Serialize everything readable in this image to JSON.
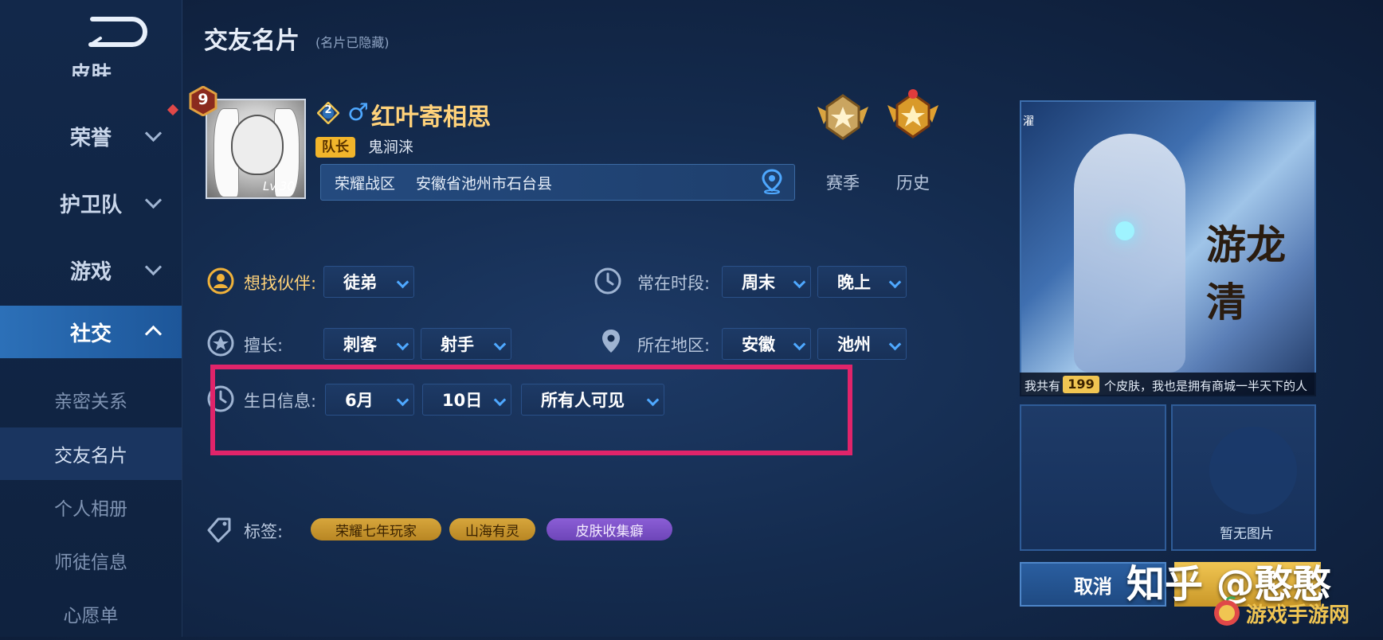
{
  "header": {
    "title": "交友名片",
    "subtitle": "(名片已隐藏)"
  },
  "sidebar": {
    "items": [
      {
        "label": "皮肤",
        "partial": true
      },
      {
        "label": "荣誉"
      },
      {
        "label": "护卫队"
      },
      {
        "label": "游戏"
      },
      {
        "label": "社交",
        "active": true
      }
    ],
    "subitems": [
      {
        "label": "亲密关系"
      },
      {
        "label": "交友名片",
        "current": true
      },
      {
        "label": "个人相册"
      },
      {
        "label": "师徒信息"
      },
      {
        "label": "心愿单"
      }
    ]
  },
  "profile": {
    "rank_number": "9",
    "avatar_level": "Lv.30",
    "level_badge": "2",
    "gender_icon": "♂",
    "name": "红叶寄相思",
    "captain_tag": "队长",
    "team_name": "鬼涧涞",
    "zone_label": "荣耀战区",
    "zone_value": "安徽省池州市石台县",
    "medals": [
      {
        "label": "赛季"
      },
      {
        "label": "历史"
      }
    ]
  },
  "form": {
    "partner": {
      "label": "想找伙伴:",
      "value": "徒弟"
    },
    "time": {
      "label": "常在时段:",
      "day": "周末",
      "period": "晚上"
    },
    "skill": {
      "label": "擅长:",
      "first": "刺客",
      "second": "射手"
    },
    "region": {
      "label": "所在地区:",
      "province": "安徽",
      "city": "池州"
    },
    "birthday": {
      "label": "生日信息:",
      "month": "6月",
      "day": "10日",
      "visibility": "所有人可见"
    },
    "tags": {
      "label": "标签:",
      "items": [
        "荣耀七年玩家",
        "山海有灵",
        "皮肤收集癖"
      ]
    }
  },
  "right_panel": {
    "skin_title": "游龙清",
    "skin_small": "濯",
    "caption_prefix": "我共有",
    "skin_count": "199",
    "caption_suffix": "个皮肤，我也是拥有商城一半天下的人",
    "no_photo": "暂无图片",
    "cancel_label": "取消"
  },
  "watermark": {
    "text": "知乎 @憨憨",
    "corner_text": "游戏手游网"
  },
  "colors": {
    "accent_gold": "#ffd27a",
    "highlight_box": "#e0246a",
    "tag_purple": "#7b4fc9",
    "active_nav": "#2c70b8"
  }
}
